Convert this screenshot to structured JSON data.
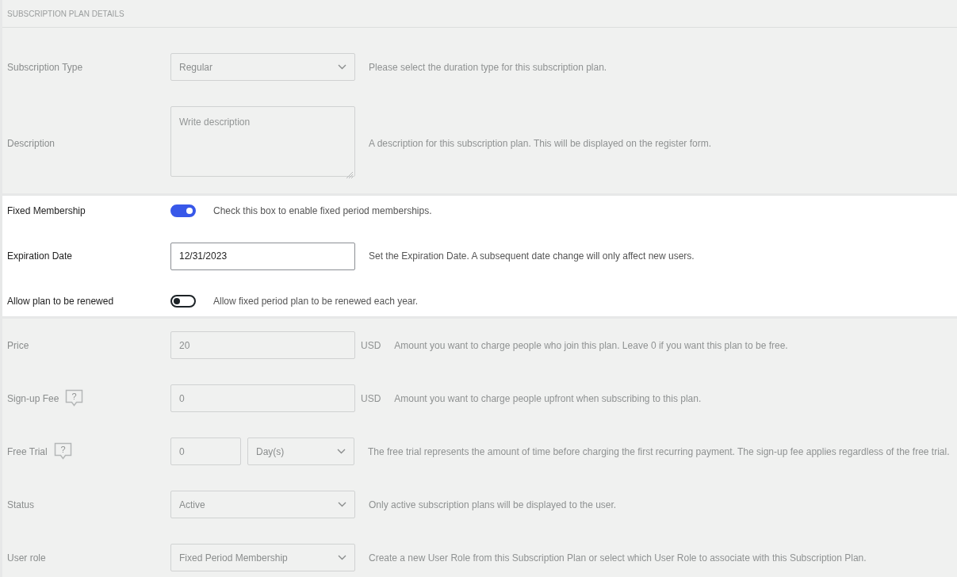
{
  "header": "SUBSCRIPTION PLAN DETAILS",
  "sections": [
    {
      "highlighted": false,
      "rows": [
        {
          "label": "Subscription Type",
          "controls": [
            {
              "kind": "select",
              "value": "Regular"
            }
          ],
          "description": "Please select the duration type for this subscription plan."
        },
        {
          "label": "Description",
          "controls": [
            {
              "kind": "textarea",
              "placeholder": "Write description"
            }
          ],
          "description": "A description for this subscription plan. This will be displayed on the register form."
        }
      ]
    },
    {
      "highlighted": true,
      "rows": [
        {
          "label": "Fixed Membership",
          "controls": [
            {
              "kind": "toggle",
              "on": true
            }
          ],
          "description": "Check this box to enable fixed period memberships."
        },
        {
          "label": "Expiration Date",
          "controls": [
            {
              "kind": "input",
              "value": "12/31/2023"
            }
          ],
          "description": "Set the Expiration Date. A subsequent date change will only affect new users."
        },
        {
          "label": "Allow plan to be renewed",
          "controls": [
            {
              "kind": "toggle",
              "on": false
            }
          ],
          "description": "Allow fixed period plan to be renewed each year."
        }
      ]
    },
    {
      "highlighted": false,
      "rows": [
        {
          "label": "Price",
          "controls": [
            {
              "kind": "input",
              "value": "20"
            }
          ],
          "unit": "USD",
          "description": "Amount you want to charge people who join this plan. Leave 0 if you want this plan to be free."
        },
        {
          "label": "Sign-up Fee",
          "help": "?",
          "controls": [
            {
              "kind": "input",
              "value": "0"
            }
          ],
          "unit": "USD",
          "description": "Amount you want to charge people upfront when subscribing to this plan."
        },
        {
          "label": "Free Trial",
          "help": "?",
          "controls": [
            {
              "kind": "input",
              "value": "0"
            },
            {
              "kind": "select",
              "value": "Day(s)"
            }
          ],
          "description": "The free trial represents the amount of time before charging the first recurring payment. The sign-up fee applies regardless of the free trial."
        },
        {
          "label": "Status",
          "controls": [
            {
              "kind": "select",
              "value": "Active"
            }
          ],
          "description": "Only active subscription plans will be displayed to the user."
        },
        {
          "label": "User role",
          "controls": [
            {
              "kind": "select",
              "value": "Fixed Period Membership"
            }
          ],
          "description": "Create a new User Role from this Subscription Plan or select which User Role to associate with this Subscription Plan."
        }
      ]
    }
  ]
}
